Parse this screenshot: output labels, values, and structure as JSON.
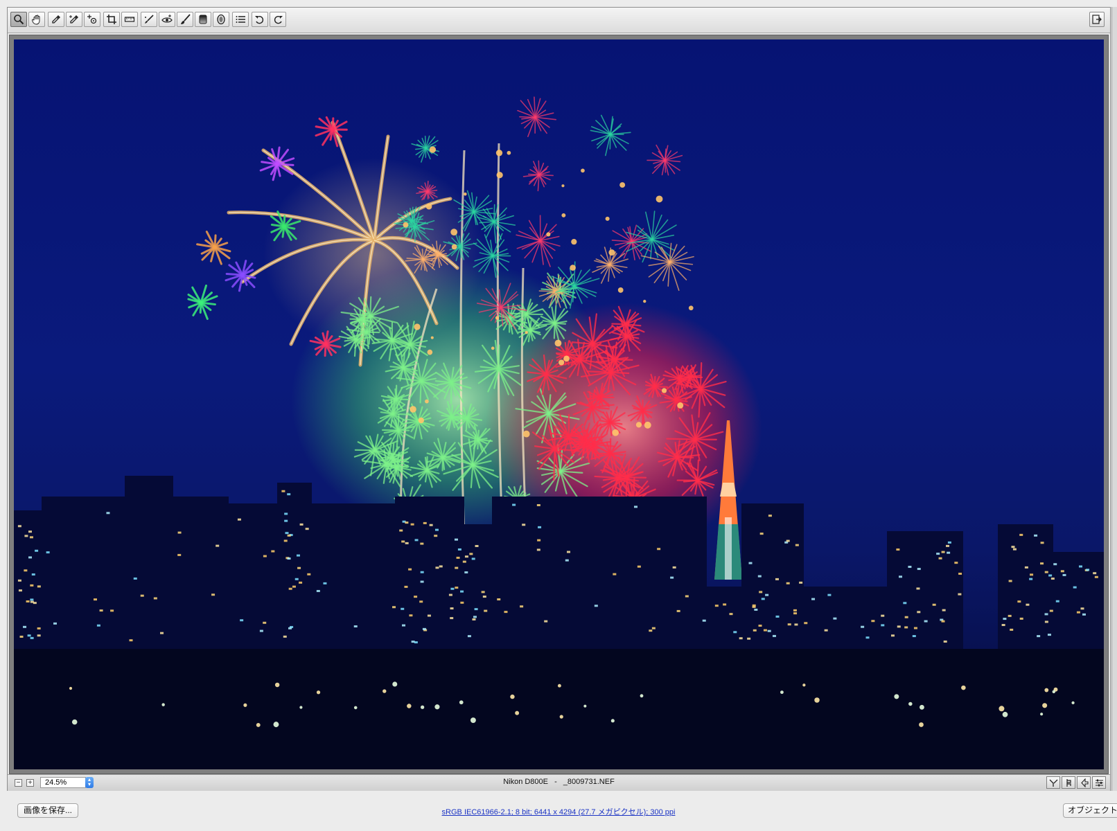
{
  "toolbar": {
    "tools": [
      {
        "icon": "zoom-icon",
        "active": true
      },
      {
        "icon": "hand-icon",
        "active": false
      },
      {
        "icon": "eyedropper-icon",
        "active": false
      },
      {
        "icon": "color-sampler-icon",
        "active": false
      },
      {
        "icon": "target-adjust-icon",
        "active": false
      },
      {
        "icon": "crop-icon",
        "active": false
      },
      {
        "icon": "straighten-icon",
        "active": false
      },
      {
        "icon": "spot-removal-icon",
        "active": false
      },
      {
        "icon": "red-eye-icon",
        "active": false
      },
      {
        "icon": "brush-icon",
        "active": false
      },
      {
        "icon": "graduated-filter-icon",
        "active": false
      },
      {
        "icon": "radial-filter-icon",
        "active": false
      },
      {
        "icon": "preferences-list-icon",
        "active": false
      },
      {
        "icon": "rotate-left-icon",
        "active": false
      },
      {
        "icon": "rotate-right-icon",
        "active": false
      }
    ],
    "export_icon": "export-icon"
  },
  "status": {
    "zoom_out_icon": "minus-icon",
    "zoom_in_icon": "plus-icon",
    "zoom_value": "24.5%",
    "camera": "Nikon D800E",
    "separator": "-",
    "filename": "_8009731.NEF",
    "right_tools": [
      "histogram-filter-icon",
      "clipping-icon",
      "preview-toggle-icon",
      "settings-sliders-icon"
    ]
  },
  "footer": {
    "save_button": "画像を保存...",
    "profile_link": "sRGB IEC61966-2.1; 8 bit; 6441 x 4294 (27.7 メガピクセル); 300 ppi",
    "object_button": "オブジェクト"
  },
  "colors": {
    "sky": "#0a1a7c",
    "firework_gold": "#e8b36a",
    "firework_green": "#7ef08a",
    "firework_red": "#ff2d4a",
    "link": "#1a33c4"
  }
}
